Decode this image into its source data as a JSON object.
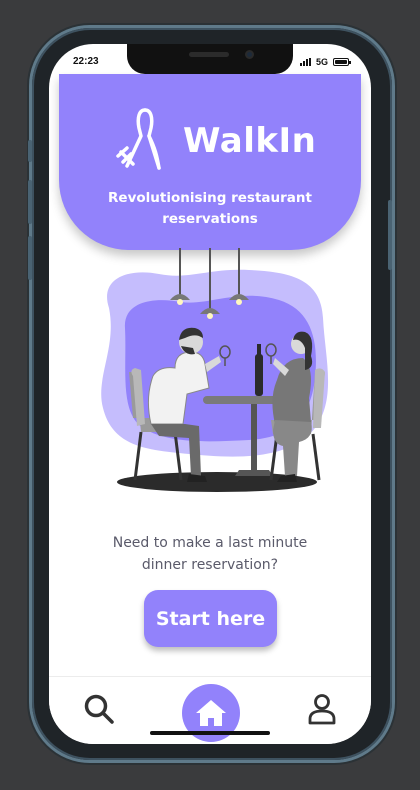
{
  "status_bar": {
    "time": "22:23",
    "network": "5G"
  },
  "header": {
    "brand": "WalkIn",
    "tagline_line1": "Revolutionising restaurant",
    "tagline_line2": "reservations"
  },
  "prompt": {
    "line1": "Need to make a last minute",
    "line2": "dinner reservation?"
  },
  "cta": {
    "label": "Start here"
  },
  "nav": {
    "items": [
      {
        "icon": "search-icon"
      },
      {
        "icon": "home-icon",
        "active": true
      },
      {
        "icon": "user-icon"
      }
    ]
  },
  "colors": {
    "accent": "#9282fb",
    "text_muted": "#5a5a6a"
  }
}
